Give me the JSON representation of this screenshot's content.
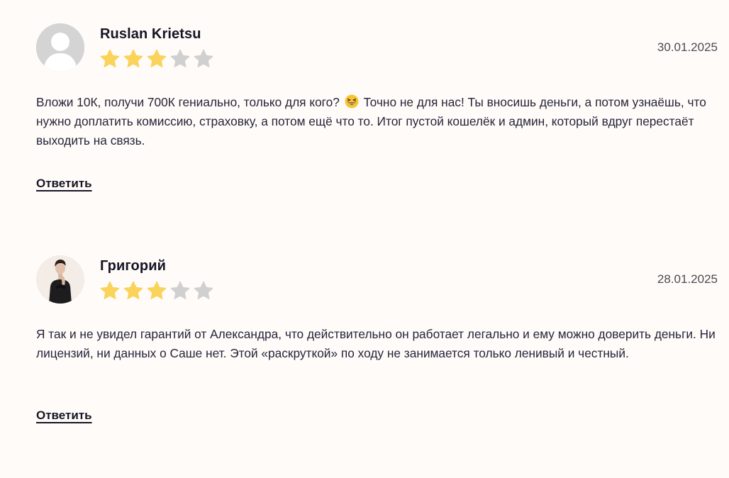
{
  "reviews": [
    {
      "author": "Ruslan Krietsu",
      "rating": 3,
      "max_rating": 5,
      "date": "30.01.2025",
      "text_before_emoji": "Вложи 10К, получи 700К гениально, только для кого?",
      "emoji": "grinning-squinting-face-emoji",
      "text_after_emoji": "Точно не для нас! Ты вносишь деньги, а потом узнаёшь, что нужно доплатить комиссию, страховку, а потом ещё что то. Итог пустой кошелёк и админ, который вдруг перестаёт выходить на связь.",
      "reply_label": "Ответить",
      "avatar": "default-user-avatar"
    },
    {
      "author": "Григорий",
      "rating": 3,
      "max_rating": 5,
      "date": "28.01.2025",
      "text": "Я так и не увидел гарантий от Александра, что действительно он работает легально и ему можно доверить деньги. Ни лицензий, ни данных о Саше нет. Этой «раскруткой» по ходу не занимается только ленивый и честный.",
      "reply_label": "Ответить",
      "avatar": "user-photo-avatar"
    }
  ],
  "colors": {
    "background": "#fffbf8",
    "star_filled": "#f9d35a",
    "star_empty": "#d0d0d0",
    "text": "#25253a"
  }
}
